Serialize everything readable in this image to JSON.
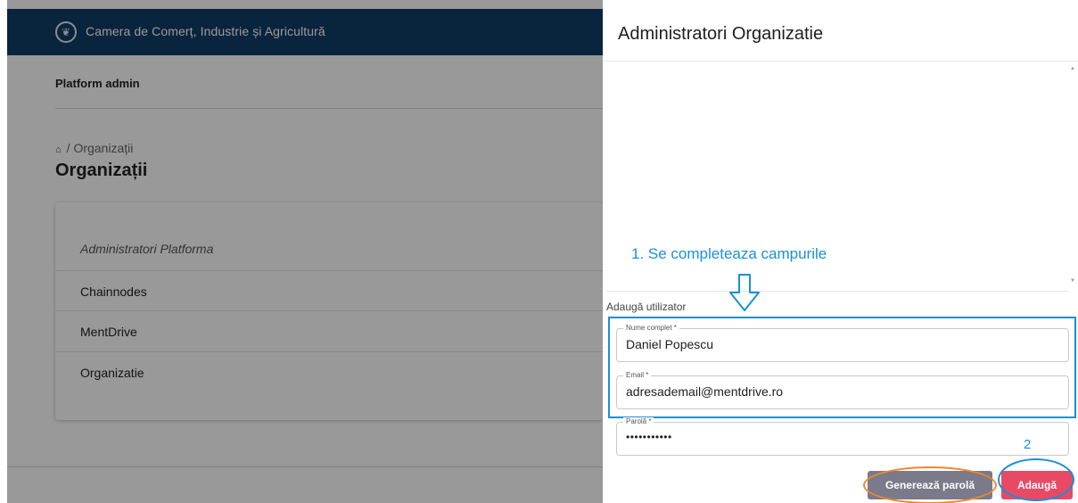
{
  "header": {
    "organization": "Camera de Comerț, Industrie și Agricultură",
    "logo_icon": "seal-logo-icon"
  },
  "nav": {
    "platform_admin": "Platform admin"
  },
  "breadcrumb": {
    "home_icon": "home-icon",
    "separator": "/",
    "current": "Organizații"
  },
  "page": {
    "title": "Organizații"
  },
  "organizations": [
    "Administratori Platforma",
    "Chainnodes",
    "MentDrive",
    "Organizatie"
  ],
  "drawer": {
    "title": "Administratori Organizatie",
    "add_user_label": "Adaugă utilizator",
    "fields": {
      "name": {
        "label": "Nume complet *",
        "value": "Daniel Popescu"
      },
      "email": {
        "label": "Email *",
        "value": "adresademail@mentdrive.ro"
      },
      "password": {
        "label": "Parolă *",
        "value": "•••••••••••"
      }
    },
    "buttons": {
      "generate_password": "Generează parolă",
      "add": "Adaugă"
    }
  },
  "annotations": {
    "step1": "1.  Se completeaza campurile",
    "step2": "2"
  },
  "colors": {
    "topbar": "#0f3c66",
    "annotation_blue": "#1a8fd6",
    "annotation_orange": "#f0872b",
    "add_button": "#e84a66",
    "generate_button": "#7a7a8a"
  }
}
